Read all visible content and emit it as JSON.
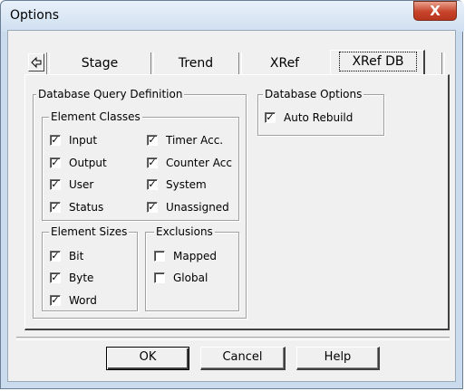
{
  "window": {
    "title": "Options",
    "close_label": "X"
  },
  "tabs": [
    {
      "label": "Stage"
    },
    {
      "label": "Trend"
    },
    {
      "label": "XRef"
    },
    {
      "label": "XRef DB",
      "active": true
    }
  ],
  "query_group": {
    "label": "Database Query Definition"
  },
  "element_classes": {
    "label": "Element Classes",
    "items": [
      {
        "label": "Input",
        "checked": true
      },
      {
        "label": "Output",
        "checked": true
      },
      {
        "label": "User",
        "checked": true
      },
      {
        "label": "Status",
        "checked": true
      },
      {
        "label": "Timer Acc.",
        "checked": true
      },
      {
        "label": "Counter Acc",
        "checked": true
      },
      {
        "label": "System",
        "checked": true
      },
      {
        "label": "Unassigned",
        "checked": true
      }
    ]
  },
  "element_sizes": {
    "label": "Element Sizes",
    "items": [
      {
        "label": "Bit",
        "checked": true
      },
      {
        "label": "Byte",
        "checked": true
      },
      {
        "label": "Word",
        "checked": true
      }
    ]
  },
  "exclusions": {
    "label": "Exclusions",
    "items": [
      {
        "label": "Mapped",
        "checked": false
      },
      {
        "label": "Global",
        "checked": false
      }
    ]
  },
  "db_options": {
    "label": "Database Options",
    "items": [
      {
        "label": "Auto Rebuild",
        "checked": true
      }
    ]
  },
  "buttons": {
    "ok": "OK",
    "cancel": "Cancel",
    "help": "Help"
  },
  "colors": {
    "frame": "#c9dbec",
    "face": "#f0f0f0",
    "close": "#c7432a"
  }
}
